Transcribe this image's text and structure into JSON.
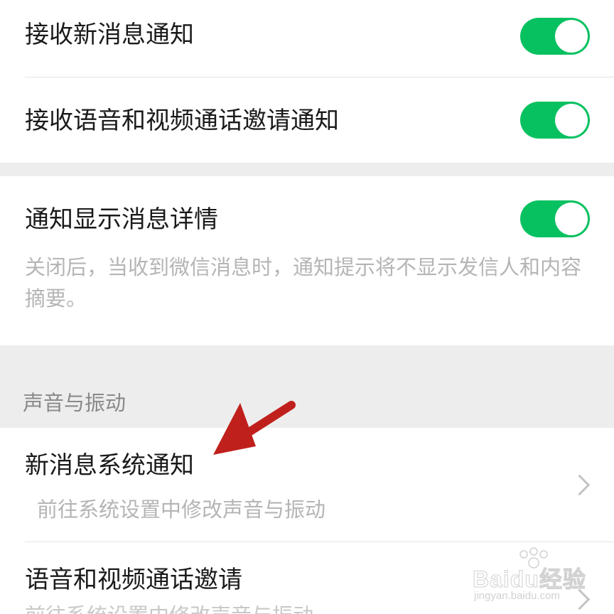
{
  "group1": {
    "items": [
      {
        "title": "接收新消息通知",
        "enabled": true
      },
      {
        "title": "接收语音和视频通话邀请通知",
        "enabled": true
      }
    ]
  },
  "group2": {
    "title": "通知显示消息详情",
    "enabled": true,
    "description": "关闭后，当收到微信消息时，通知提示将不显示发信人和内容摘要。"
  },
  "sound_section": {
    "header": "声音与振动",
    "items": [
      {
        "title": "新消息系统通知",
        "subtitle": "前往系统设置中修改声音与振动"
      },
      {
        "title": "语音和视频通话邀请",
        "subtitle": "前往系统设置中修改声音与振动"
      }
    ]
  },
  "annotation": {
    "arrow_color": "#c0201c"
  },
  "watermark": {
    "brand": "Baidu经验",
    "url": "jingyan.baidu.com"
  },
  "colors": {
    "accent": "#07c160",
    "background": "#ededed",
    "card": "#ffffff",
    "primary_text": "#1a1a1a",
    "secondary_text": "#b5b5b5",
    "section_text": "#8a8a8a"
  }
}
